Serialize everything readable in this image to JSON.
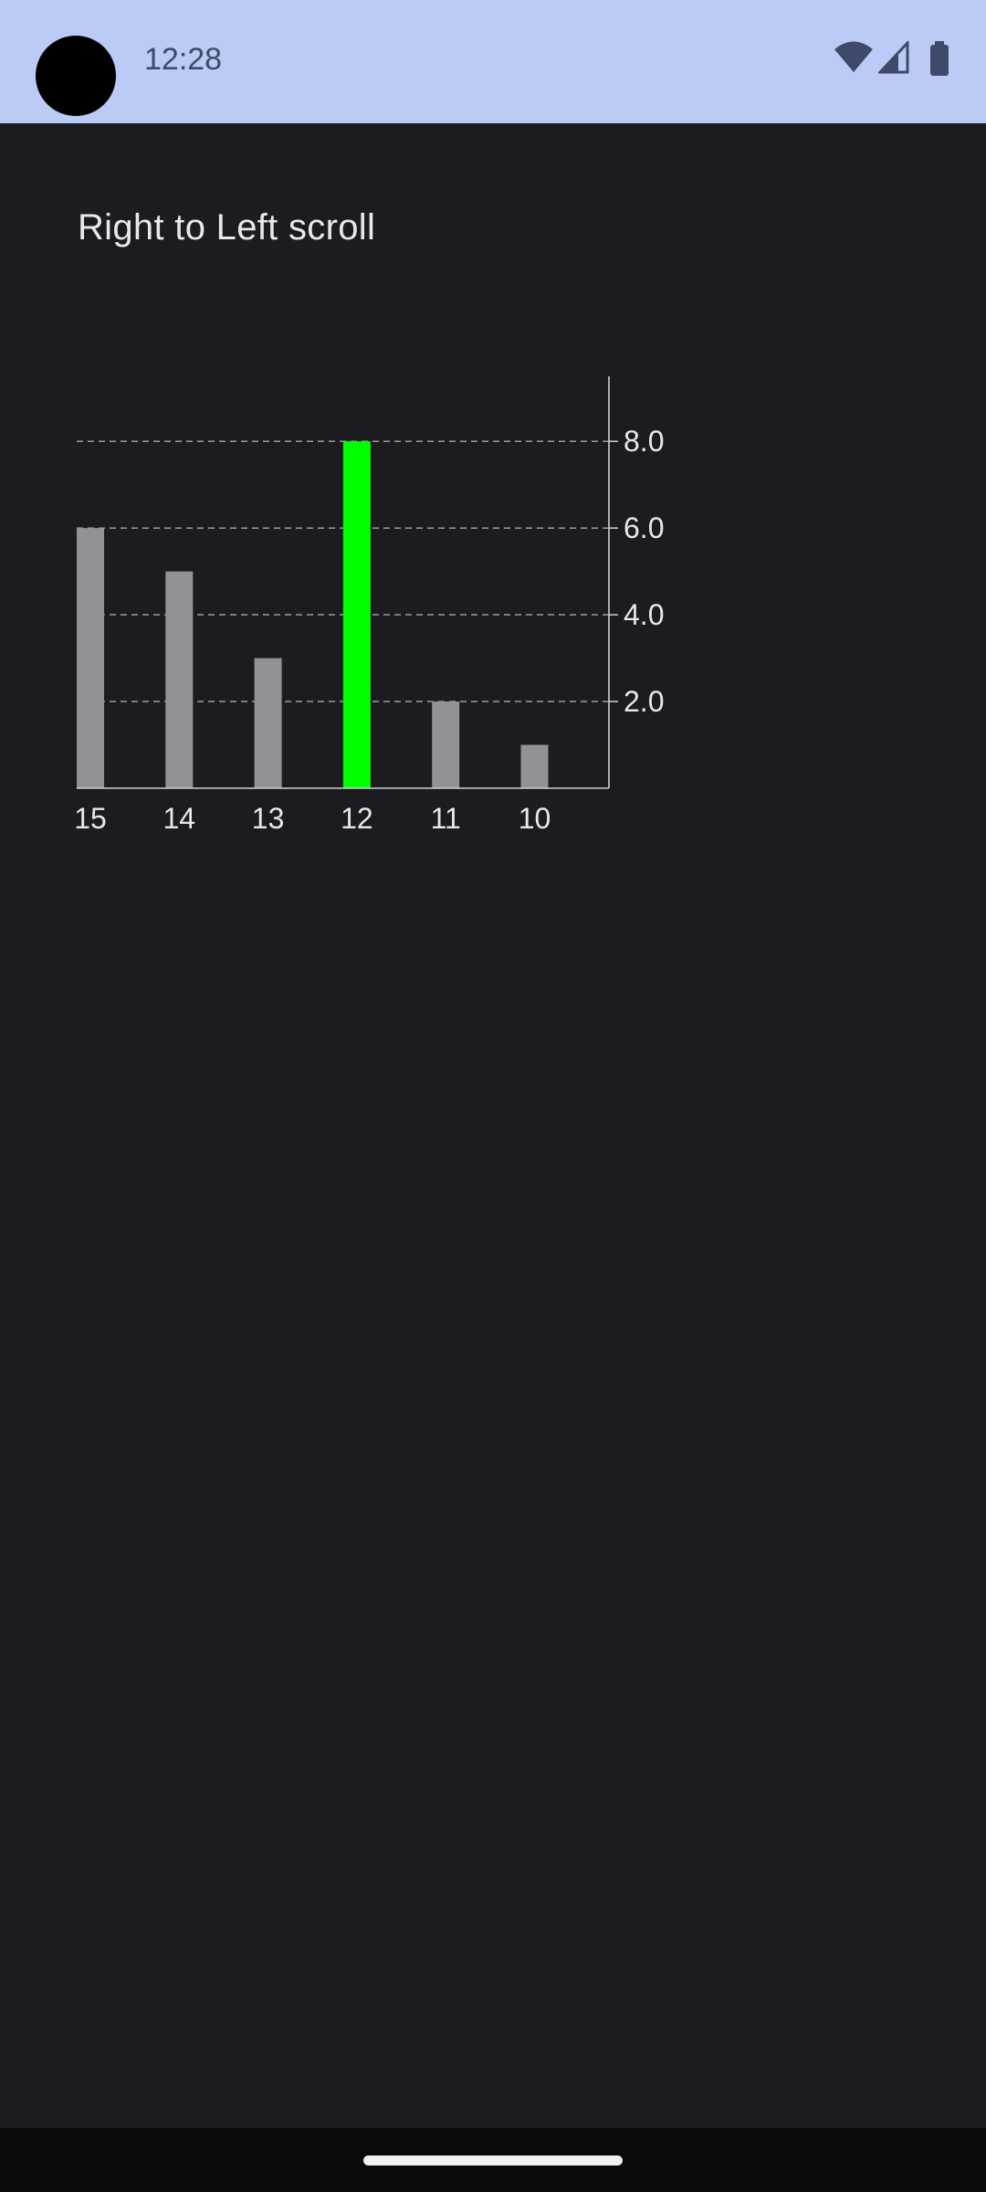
{
  "status_bar": {
    "time": "12:28",
    "icons": [
      "wifi-icon",
      "cellular-signal-icon",
      "battery-icon"
    ],
    "background": "#bccbf5"
  },
  "screen": {
    "background": "#1c1b20"
  },
  "chart_data": {
    "type": "bar",
    "title": "Right to Left scroll",
    "categories": [
      "15",
      "14",
      "13",
      "12",
      "11",
      "10"
    ],
    "values": [
      6,
      5,
      3,
      8,
      2,
      1
    ],
    "highlight_index": 3,
    "bar_color": "#939196",
    "highlight_color": "#00ff00",
    "y_axis_position": "right",
    "y_ticks": [
      "2.0",
      "4.0",
      "6.0",
      "8.0"
    ],
    "y_tick_values": [
      2,
      4,
      6,
      8
    ],
    "ylim": [
      0,
      9.5
    ],
    "grid": "dashed horizontal",
    "xlabel": "",
    "ylabel": ""
  }
}
